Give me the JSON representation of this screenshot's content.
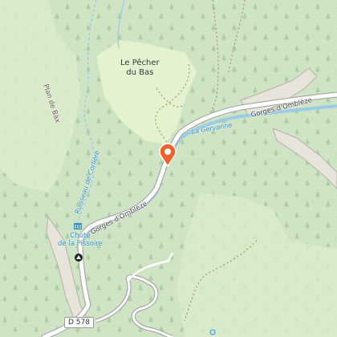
{
  "map": {
    "labels": {
      "hamlet": "Le Pêcher\ndu Bas",
      "gorges_east": "Gorges d'Omblèze",
      "gorges_west": "Gorges d'Omblèze",
      "river": "La Gervanne",
      "stream": "Ruisseau de Corlière",
      "ridge": "Plan de Bàx",
      "waterfall": "Chute\nde la Pissoire",
      "road_ref": "D 578"
    },
    "marker": {
      "name": "location-pin",
      "color": "#f0622a"
    },
    "icons": {
      "waterfall": "waterfall-icon",
      "viewpoint": "viewpoint-icon",
      "parking": "parking-icon"
    },
    "colors": {
      "forest": "#cfe3c5",
      "meadow": "#e3f2cf",
      "rock": "#e7e4dc",
      "water": "#9ccbe8",
      "road": "#ffffff"
    }
  }
}
